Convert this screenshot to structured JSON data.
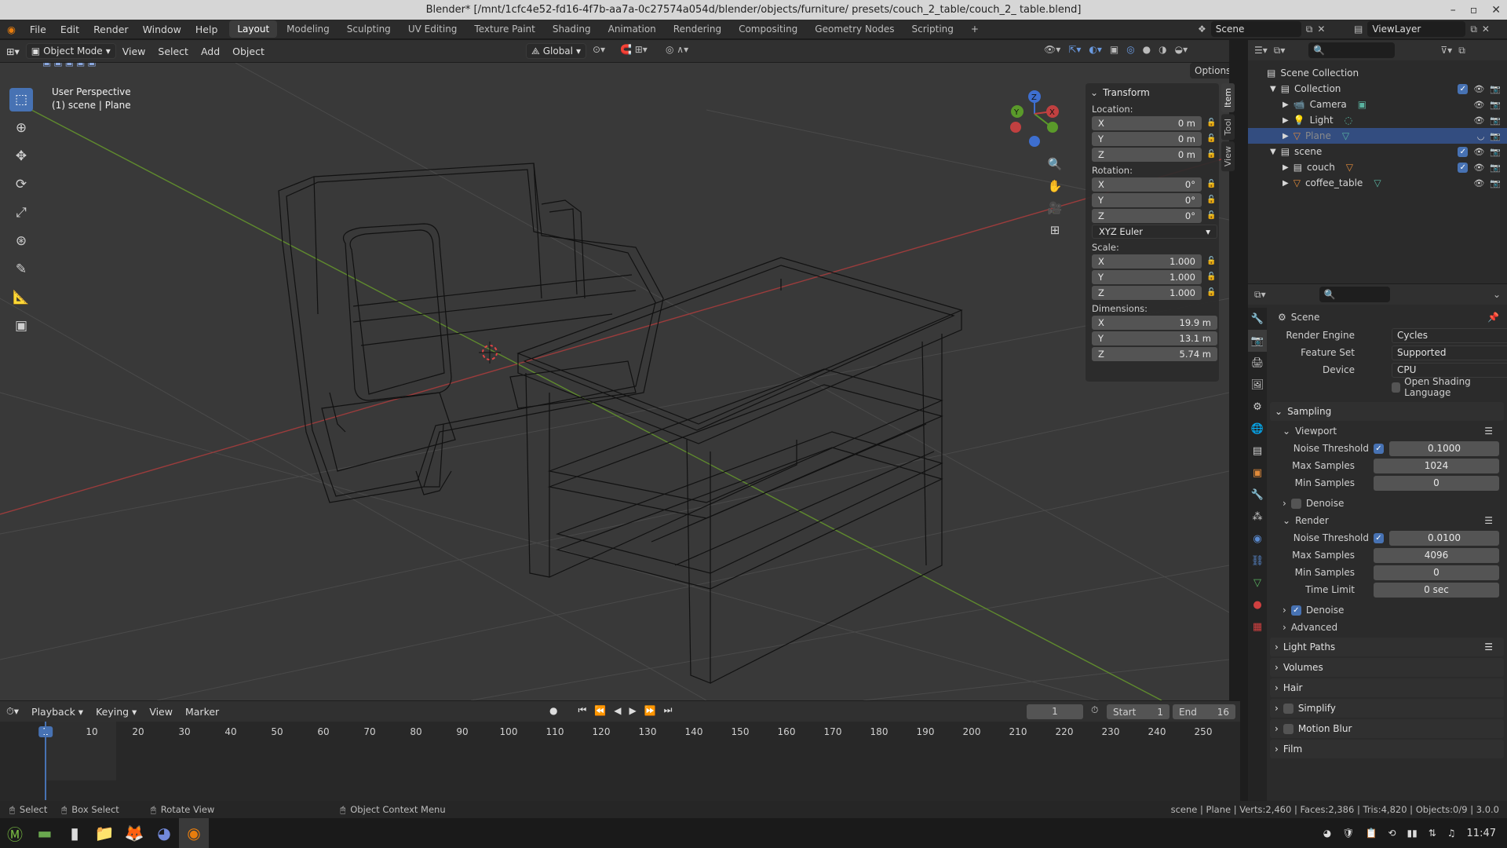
{
  "titlebar": {
    "title": "Blender* [/mnt/1cfc4e52-fd16-4f7b-aa7a-0c27574a054d/blender/objects/furniture/ presets/couch_2_table/couch_2_ table.blend]"
  },
  "menu": {
    "items": [
      "File",
      "Edit",
      "Render",
      "Window",
      "Help"
    ]
  },
  "workspaces": [
    "Layout",
    "Modeling",
    "Sculpting",
    "UV Editing",
    "Texture Paint",
    "Shading",
    "Animation",
    "Rendering",
    "Compositing",
    "Geometry Nodes",
    "Scripting"
  ],
  "scene_field": "Scene",
  "viewlayer_field": "ViewLayer",
  "viewport_header": {
    "mode": "Object Mode",
    "menus": [
      "View",
      "Select",
      "Add",
      "Object"
    ],
    "transform": "Global",
    "options": "Options"
  },
  "viewport": {
    "perspective": "User Perspective",
    "context": "(1) scene | Plane"
  },
  "npanel": {
    "title": "Transform",
    "location_label": "Location:",
    "location": [
      {
        "axis": "X",
        "value": "0 m"
      },
      {
        "axis": "Y",
        "value": "0 m"
      },
      {
        "axis": "Z",
        "value": "0 m"
      }
    ],
    "rotation_label": "Rotation:",
    "rotation": [
      {
        "axis": "X",
        "value": "0°"
      },
      {
        "axis": "Y",
        "value": "0°"
      },
      {
        "axis": "Z",
        "value": "0°"
      }
    ],
    "rotation_mode": "XYZ Euler",
    "scale_label": "Scale:",
    "scale": [
      {
        "axis": "X",
        "value": "1.000"
      },
      {
        "axis": "Y",
        "value": "1.000"
      },
      {
        "axis": "Z",
        "value": "1.000"
      }
    ],
    "dimensions_label": "Dimensions:",
    "dimensions": [
      {
        "axis": "X",
        "value": "19.9 m"
      },
      {
        "axis": "Y",
        "value": "13.1 m"
      },
      {
        "axis": "Z",
        "value": "5.74 m"
      }
    ],
    "tabs": [
      "Item",
      "Tool",
      "View"
    ]
  },
  "outliner": {
    "rows": [
      {
        "label": "Scene Collection",
        "indent": 0
      },
      {
        "label": "Collection",
        "indent": 1
      },
      {
        "label": "Camera",
        "indent": 2
      },
      {
        "label": "Light",
        "indent": 2
      },
      {
        "label": "Plane",
        "indent": 2
      },
      {
        "label": "scene",
        "indent": 1
      },
      {
        "label": "couch",
        "indent": 2
      },
      {
        "label": "coffee_table",
        "indent": 2
      }
    ]
  },
  "properties": {
    "context": "Scene",
    "render_engine_label": "Render Engine",
    "render_engine": "Cycles",
    "feature_set_label": "Feature Set",
    "feature_set": "Supported",
    "device_label": "Device",
    "device": "CPU",
    "osl_label": "Open Shading Language",
    "sampling": "Sampling",
    "viewport": "Viewport",
    "vp_noise_label": "Noise Threshold",
    "vp_noise": "0.1000",
    "vp_max_label": "Max Samples",
    "vp_max": "1024",
    "vp_min_label": "Min Samples",
    "vp_min": "0",
    "denoise": "Denoise",
    "render": "Render",
    "r_noise_label": "Noise Threshold",
    "r_noise": "0.0100",
    "r_max_label": "Max Samples",
    "r_max": "4096",
    "r_min_label": "Min Samples",
    "r_min": "0",
    "r_time_label": "Time Limit",
    "r_time": "0 sec",
    "advanced": "Advanced",
    "sections": [
      "Light Paths",
      "Volumes",
      "Hair",
      "Simplify",
      "Motion Blur",
      "Film"
    ]
  },
  "timeline": {
    "menus": [
      "Playback",
      "Keying",
      "View",
      "Marker"
    ],
    "current_frame": "1",
    "start_label": "Start",
    "start": "1",
    "end_label": "End",
    "end": "16",
    "ruler": [
      "1",
      "10",
      "20",
      "30",
      "40",
      "50",
      "60",
      "70",
      "80",
      "90",
      "100",
      "110",
      "120",
      "130",
      "140",
      "150",
      "160",
      "170",
      "180",
      "190",
      "200",
      "210",
      "220",
      "230",
      "240",
      "250"
    ]
  },
  "statusbar": {
    "select": "Select",
    "box_select": "Box Select",
    "rotate_view": "Rotate View",
    "context_menu": "Object Context Menu",
    "stats": "scene | Plane | Verts:2,460 | Faces:2,386 | Tris:4,820 | Objects:0/9 | 3.0.0"
  },
  "taskbar": {
    "clock": "11:47"
  }
}
